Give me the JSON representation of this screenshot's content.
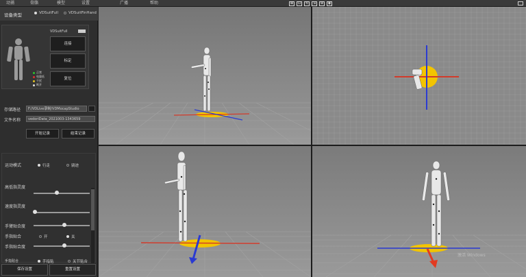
{
  "menu": [
    "动捕",
    "骨骼",
    "模型",
    "设置",
    "广播",
    "帮助"
  ],
  "view_tools": [
    "⊠",
    "⊡",
    "⟲",
    "⇲",
    "⊕",
    "◉"
  ],
  "device": {
    "label": "设备类型",
    "options": [
      "VDSuitFull",
      "VDSuitFinHand"
    ],
    "selected": "VDSuitFull"
  },
  "suit_status": "VDSuitFull",
  "actions": {
    "connect": "连接",
    "calibrate": "标定",
    "reset": "复位"
  },
  "status_legend": [
    {
      "label": "正常",
      "color": "#2ec42e"
    },
    {
      "label": "电量低",
      "color": "#e03030"
    },
    {
      "label": "干扰",
      "color": "#e0c020"
    },
    {
      "label": "断开",
      "color": "#dddddd"
    }
  ],
  "recording": {
    "path_label": "存储路径",
    "path_value": "F:/VDLive录制/VDMocapStudio",
    "file_label": "文件名称",
    "file_value": "vedoriData_2021003-1343659",
    "start": "开始记录",
    "stop": "结束记录"
  },
  "motion": {
    "mode_label": "运动模式",
    "modes": [
      "行走",
      "骑迹"
    ],
    "sliders": [
      {
        "label": "高低指灵度",
        "value": 0.42
      },
      {
        "label": "速度指灵度",
        "value": 0.02
      },
      {
        "label": "手臂贴合度",
        "value": 0.55
      },
      {
        "label": "手指贴合度",
        "value": 0.55
      }
    ],
    "hand_toggle": {
      "label": "手指贴合",
      "on": "开",
      "off": "关"
    },
    "bottom_row": {
      "label": "手指贴合",
      "opt1": "手指贴",
      "opt2": "关节贴合"
    }
  },
  "footer": {
    "save": "保存设置",
    "reset": "重置设置"
  },
  "viewports": [
    "perspective",
    "top",
    "side",
    "front"
  ],
  "watermark": "激活 Windows"
}
